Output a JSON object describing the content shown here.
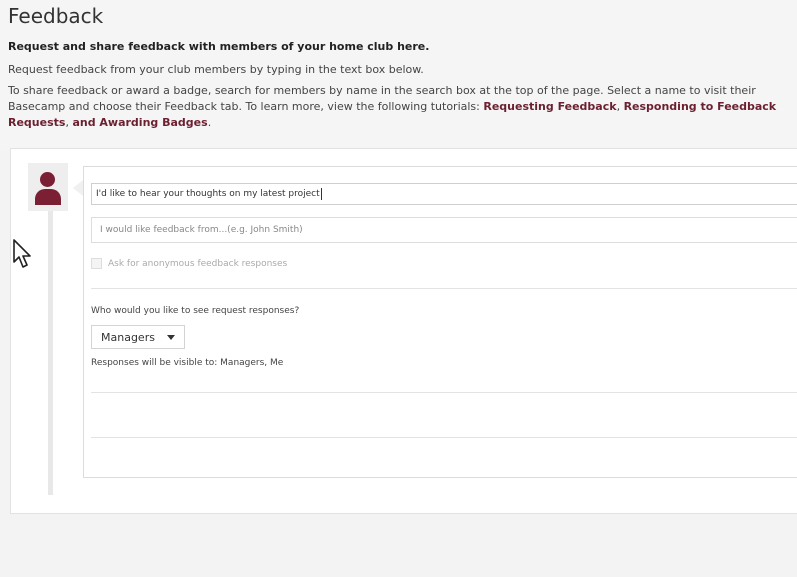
{
  "page": {
    "title": "Feedback",
    "headline": "Request and share feedback with members of your home club here.",
    "line1": "Request feedback from your club members by typing in the text box below.",
    "intro_text": "To share feedback or award a badge, search for members by name in the search box at the top of the page. Select a name to visit their Basecamp and choose their Feedback tab. To learn more, view the following tutorials: ",
    "links": [
      {
        "label": "Requesting Feedback"
      },
      {
        "label": "Responding to Feedback Requests"
      },
      {
        "label": "and Awarding Badges"
      }
    ],
    "sep1": ", ",
    "sep2": ", ",
    "end": "."
  },
  "form": {
    "request_value": "I'd like to hear your thoughts on my latest project",
    "from_placeholder": "I would like feedback from...(e.g. John Smith)",
    "anonymous_label": "Ask for anonymous feedback responses",
    "who_label": "Who would you like to see request responses?",
    "visibility_selected": "Managers",
    "visible_to": "Responses will be visible to: Managers, Me"
  },
  "colors": {
    "accent": "#7a1f34",
    "link": "#6b1f2f"
  },
  "icons": {
    "avatar": "user-icon",
    "dropdown": "caret-down-icon",
    "cursor": "mouse-pointer-icon"
  }
}
